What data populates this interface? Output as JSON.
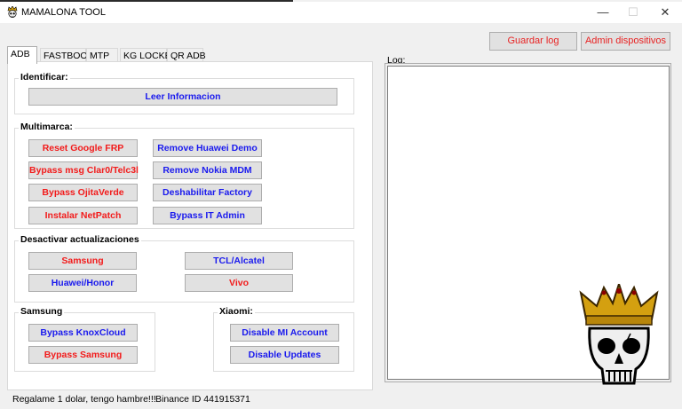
{
  "window": {
    "title": "MAMALONA TOOL",
    "minimize_glyph": "—",
    "maximize_glyph": "☐",
    "close_glyph": "✕"
  },
  "toolbar": {
    "save_log": "Guardar log",
    "admin_devices": "Admin dispositivos"
  },
  "tabs": [
    {
      "label": "ADB",
      "active": true
    },
    {
      "label": "FASTBOOT",
      "active": false
    },
    {
      "label": "MTP",
      "active": false
    },
    {
      "label": "KG LOCKED",
      "active": false
    },
    {
      "label": "QR ADB",
      "active": false
    }
  ],
  "identificar": {
    "title": "Identificar:",
    "read_info": "Leer Informacion"
  },
  "multimarca": {
    "title": "Multimarca:",
    "buttons": [
      {
        "label": "Reset Google FRP",
        "color": "red"
      },
      {
        "label": "Remove Huawei Demo",
        "color": "blue"
      },
      {
        "label": "Bypass msg Clar0/Telc3l",
        "color": "red"
      },
      {
        "label": "Remove Nokia MDM",
        "color": "blue"
      },
      {
        "label": "Bypass OjitaVerde",
        "color": "red"
      },
      {
        "label": "Deshabilitar Factory",
        "color": "blue"
      },
      {
        "label": "Instalar NetPatch",
        "color": "red"
      },
      {
        "label": "Bypass IT Admin",
        "color": "blue"
      }
    ]
  },
  "updates": {
    "title": "Desactivar actualizaciones",
    "buttons": [
      {
        "label": "Samsung",
        "color": "red"
      },
      {
        "label": "TCL/Alcatel",
        "color": "blue"
      },
      {
        "label": "Huawei/Honor",
        "color": "blue"
      },
      {
        "label": "Vivo",
        "color": "red"
      }
    ]
  },
  "samsung": {
    "title": "Samsung",
    "buttons": [
      {
        "label": "Bypass KnoxCloud",
        "color": "blue"
      },
      {
        "label": "Bypass Samsung",
        "color": "red"
      }
    ]
  },
  "xiaomi": {
    "title": "Xiaomi:",
    "buttons": [
      {
        "label": "Disable MI Account",
        "color": "blue"
      },
      {
        "label": "Disable Updates",
        "color": "blue"
      }
    ]
  },
  "log": {
    "label": "Log:",
    "content": ""
  },
  "status": {
    "donate": "Regalame 1 dolar, tengo hambre!!!",
    "binance": "Binance ID 441915371"
  },
  "colors": {
    "red_text": "#f21b1b",
    "blue_text": "#1a1aee",
    "button_bg": "#e1e1e1",
    "crown_gold": "#d4a010"
  }
}
